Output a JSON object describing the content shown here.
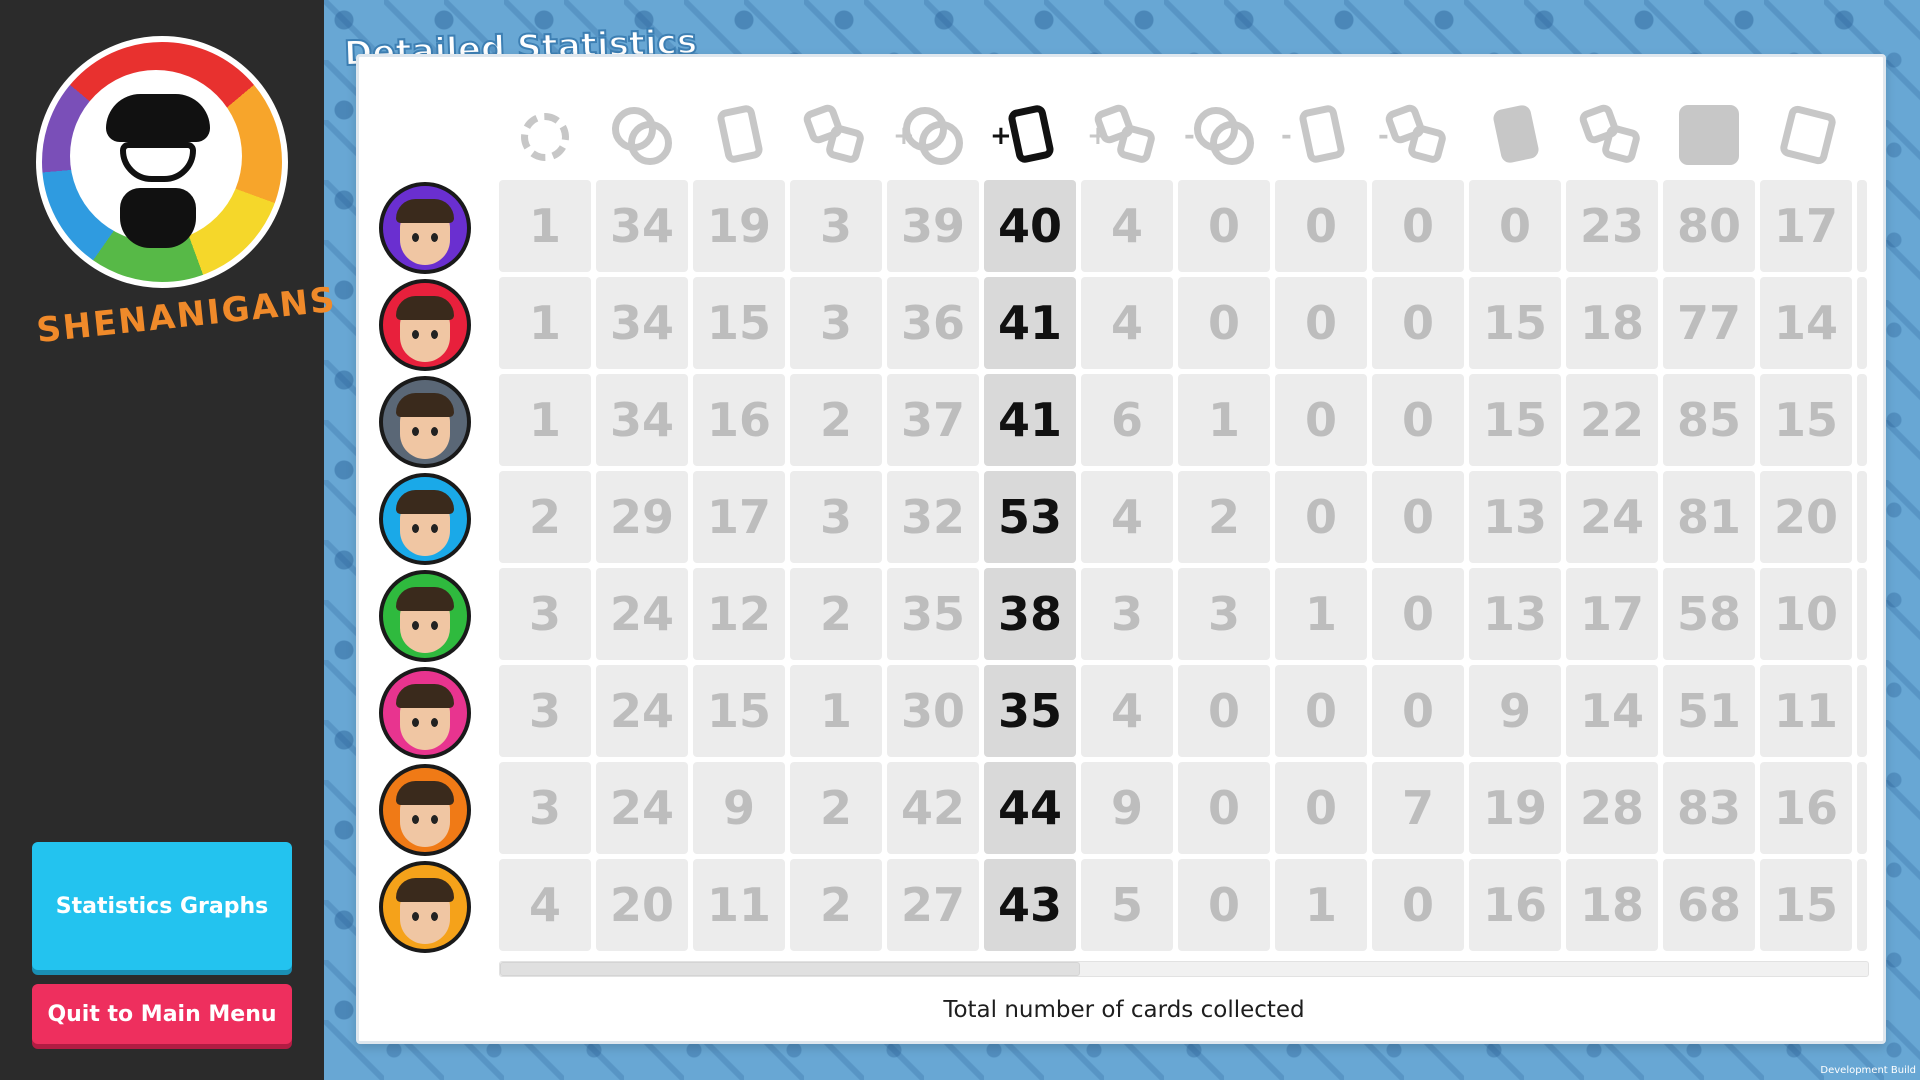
{
  "logo": {
    "text": "SHENANIGANS"
  },
  "sidebar": {
    "graphs_label": "Statistics Graphs",
    "quit_label": "Quit to Main Menu"
  },
  "title": "Detailed Statistics",
  "columns": [
    {
      "icon": "laurel-wreath-icon",
      "prefix": ""
    },
    {
      "icon": "coins-icon",
      "prefix": ""
    },
    {
      "icon": "cards-icon",
      "prefix": ""
    },
    {
      "icon": "dice-icon",
      "prefix": ""
    },
    {
      "icon": "coins-gained-icon",
      "prefix": "+"
    },
    {
      "icon": "cards-gained-icon",
      "prefix": "+"
    },
    {
      "icon": "dice-gained-icon",
      "prefix": "+"
    },
    {
      "icon": "coins-lost-icon",
      "prefix": "-"
    },
    {
      "icon": "cards-lost-icon",
      "prefix": "-"
    },
    {
      "icon": "dice-lost-icon",
      "prefix": "-"
    },
    {
      "icon": "card-played-icon",
      "prefix": ""
    },
    {
      "icon": "dice-rolled-icon",
      "prefix": ""
    },
    {
      "icon": "die-face-six-icon",
      "prefix": ""
    },
    {
      "icon": "card-stack-icon",
      "prefix": ""
    }
  ],
  "active_column": 5,
  "players": [
    {
      "name": "player-1",
      "avatar_color": "#6a2fd0",
      "values": [
        "1",
        "34",
        "19",
        "3",
        "39",
        "40",
        "4",
        "0",
        "0",
        "0",
        "0",
        "23",
        "80",
        "17"
      ]
    },
    {
      "name": "player-2",
      "avatar_color": "#e8203c",
      "values": [
        "1",
        "34",
        "15",
        "3",
        "36",
        "41",
        "4",
        "0",
        "0",
        "0",
        "15",
        "18",
        "77",
        "14"
      ]
    },
    {
      "name": "player-3",
      "avatar_color": "#5a6776",
      "values": [
        "1",
        "34",
        "16",
        "2",
        "37",
        "41",
        "6",
        "1",
        "0",
        "0",
        "15",
        "22",
        "85",
        "15"
      ]
    },
    {
      "name": "player-4",
      "avatar_color": "#1aa9e8",
      "values": [
        "2",
        "29",
        "17",
        "3",
        "32",
        "53",
        "4",
        "2",
        "0",
        "0",
        "13",
        "24",
        "81",
        "20"
      ]
    },
    {
      "name": "player-5",
      "avatar_color": "#2fba3e",
      "values": [
        "3",
        "24",
        "12",
        "2",
        "35",
        "38",
        "3",
        "3",
        "1",
        "0",
        "13",
        "17",
        "58",
        "10"
      ]
    },
    {
      "name": "player-6",
      "avatar_color": "#e8348f",
      "values": [
        "3",
        "24",
        "15",
        "1",
        "30",
        "35",
        "4",
        "0",
        "0",
        "0",
        "9",
        "14",
        "51",
        "11"
      ]
    },
    {
      "name": "player-7",
      "avatar_color": "#f07a16",
      "values": [
        "3",
        "24",
        "9",
        "2",
        "42",
        "44",
        "9",
        "0",
        "0",
        "7",
        "19",
        "28",
        "83",
        "16"
      ]
    },
    {
      "name": "player-8",
      "avatar_color": "#f5a21a",
      "values": [
        "4",
        "20",
        "11",
        "2",
        "27",
        "43",
        "5",
        "0",
        "1",
        "0",
        "16",
        "18",
        "68",
        "15"
      ]
    }
  ],
  "caption": "Total number of cards collected",
  "dev_build": "Development Build"
}
